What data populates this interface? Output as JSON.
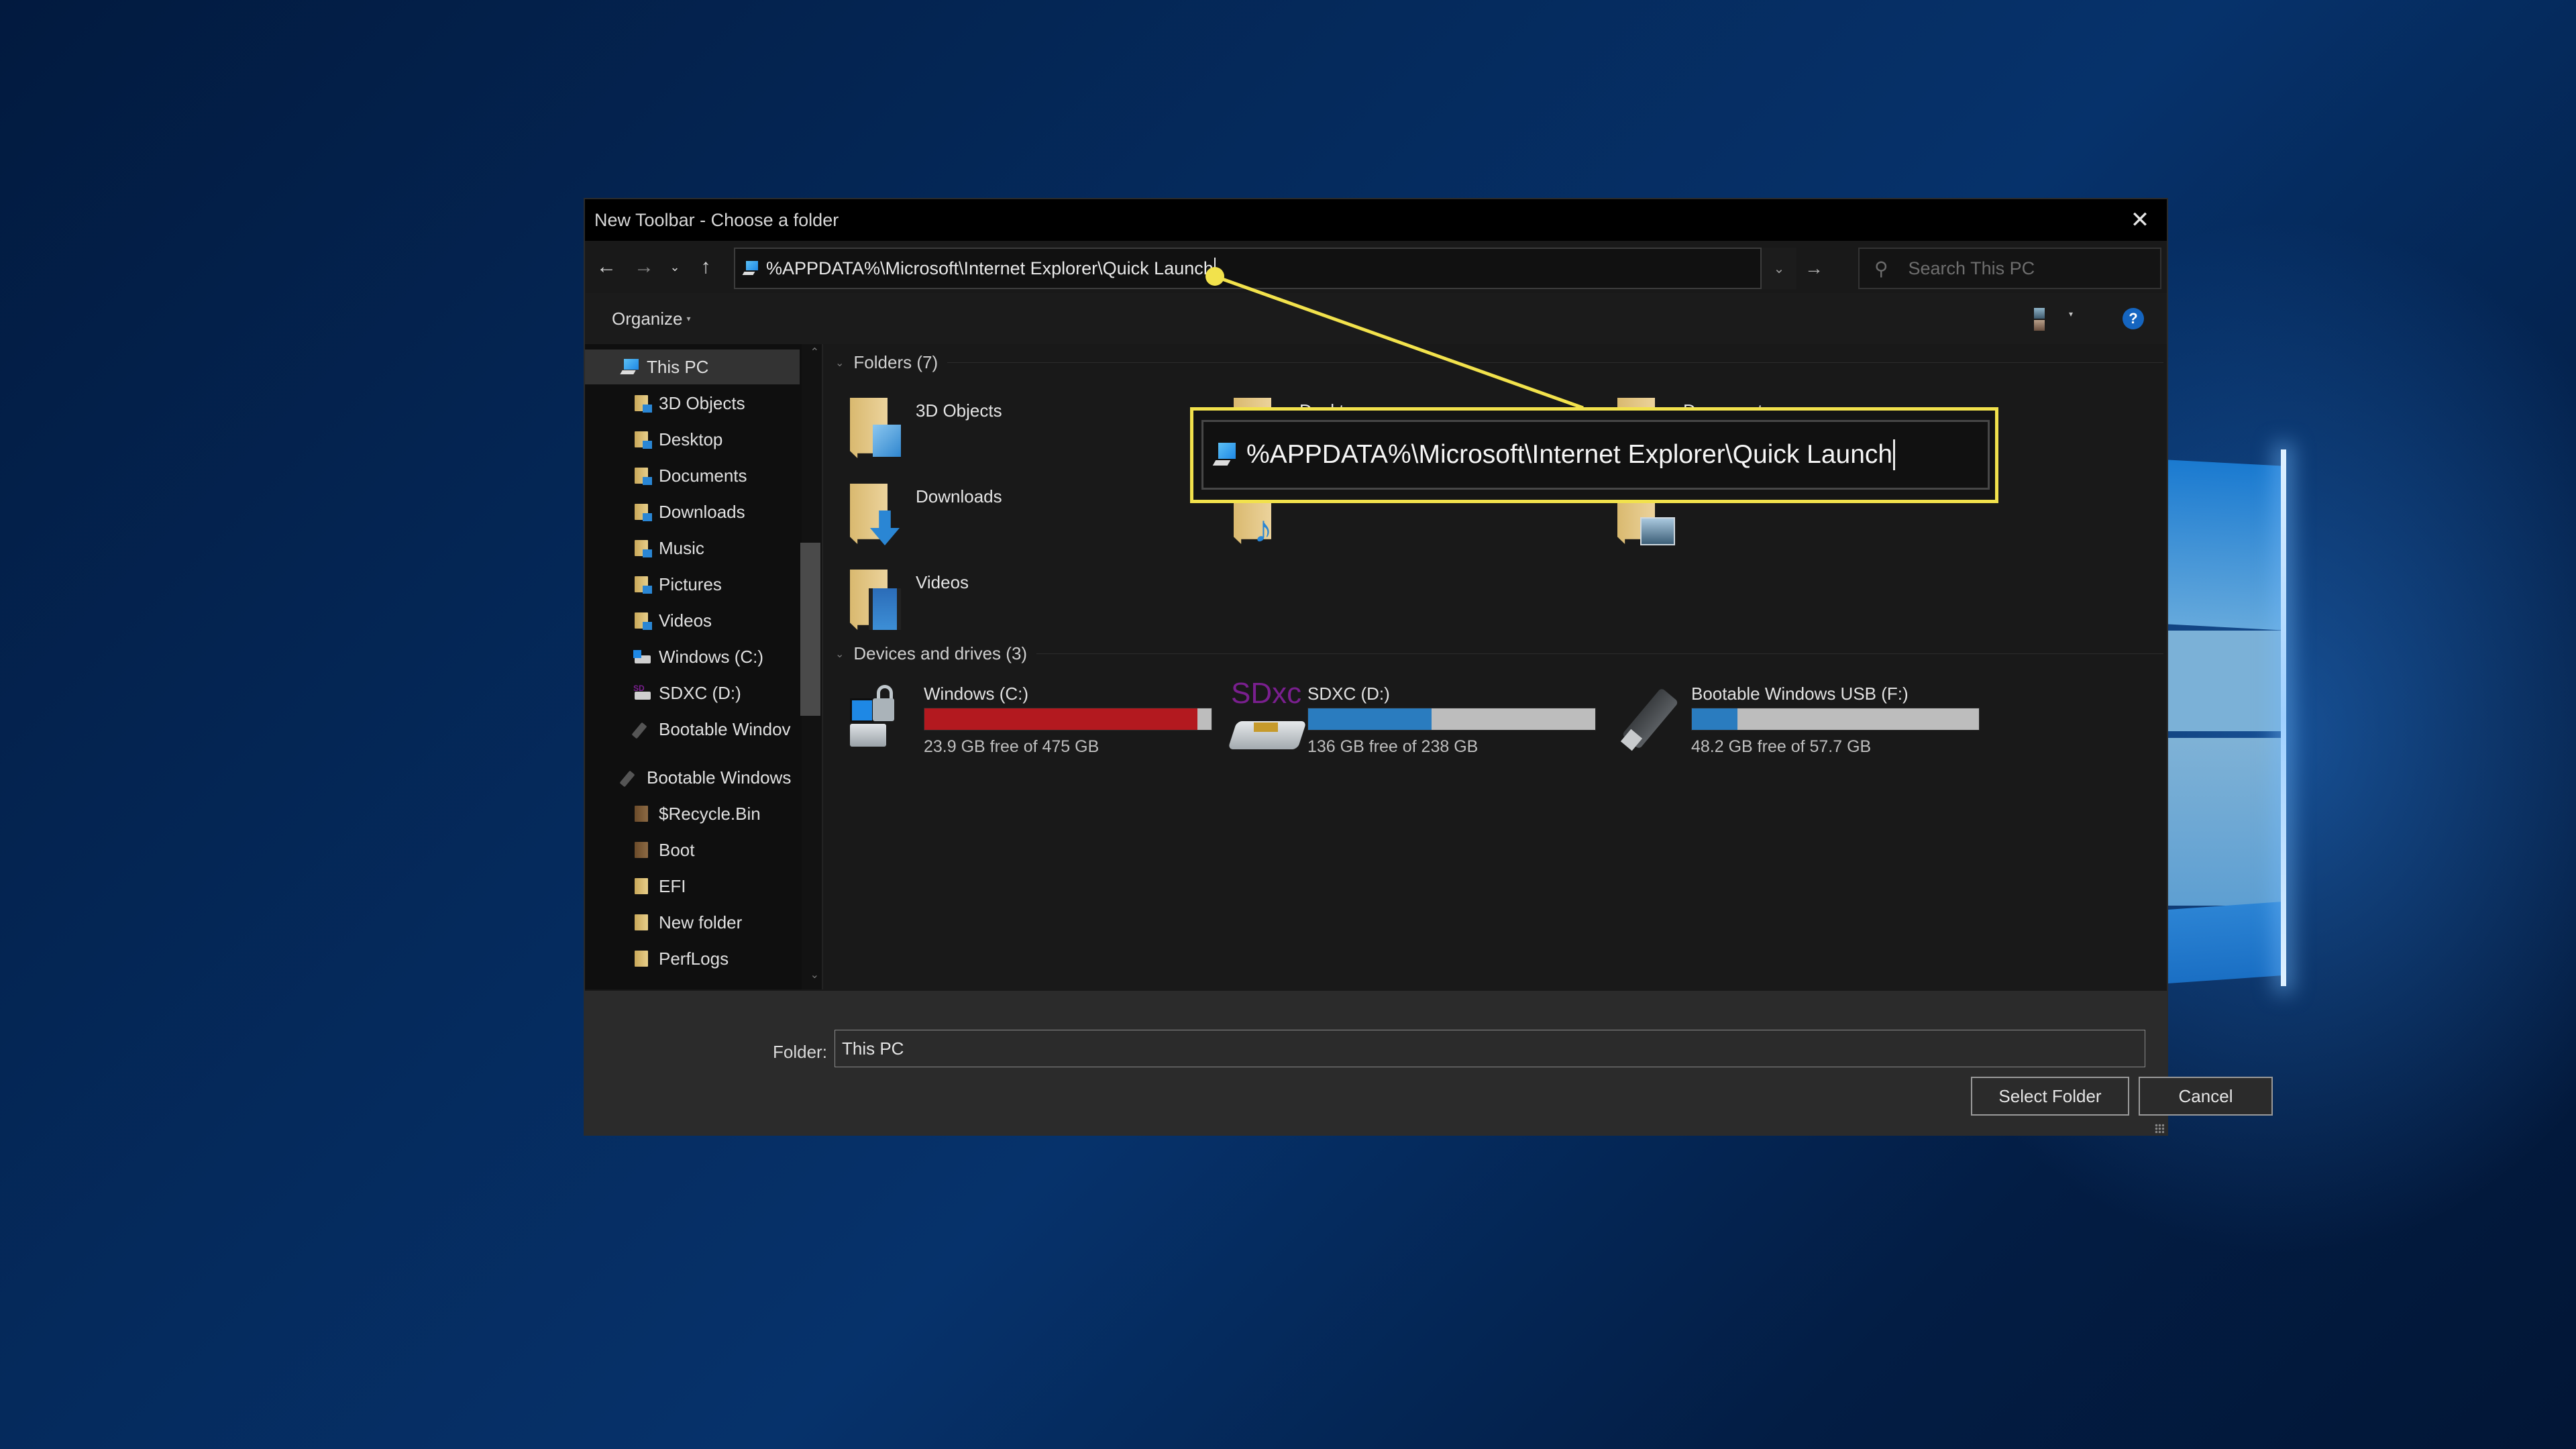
{
  "dialog": {
    "title": "New Toolbar - Choose a folder",
    "close_label": "✕"
  },
  "navigation": {
    "back_icon": "←",
    "forward_icon": "→",
    "recent_icon": "⌄",
    "up_icon": "↑",
    "address_value": "%APPDATA%\\Microsoft\\Internet Explorer\\Quick Launch",
    "dropdown_icon": "⌄",
    "go_icon": "→",
    "search_placeholder": "Search This PC",
    "search_icon": "⚲"
  },
  "toolbar": {
    "organize_label": "Organize",
    "organize_caret": "▾",
    "view_caret": "▾",
    "help_label": "?"
  },
  "sidebar": {
    "items": [
      {
        "label": "This PC",
        "icon": "pc-icon",
        "level": 0,
        "selected": true
      },
      {
        "label": "3D Objects",
        "icon": "folder-3d-objects-icon",
        "level": 1
      },
      {
        "label": "Desktop",
        "icon": "folder-desktop-icon",
        "level": 1
      },
      {
        "label": "Documents",
        "icon": "folder-documents-icon",
        "level": 1
      },
      {
        "label": "Downloads",
        "icon": "folder-downloads-icon",
        "level": 1
      },
      {
        "label": "Music",
        "icon": "folder-music-icon",
        "level": 1
      },
      {
        "label": "Pictures",
        "icon": "folder-pictures-icon",
        "level": 1
      },
      {
        "label": "Videos",
        "icon": "folder-videos-icon",
        "level": 1
      },
      {
        "label": "Windows (C:)",
        "icon": "windows-drive-icon",
        "level": 1
      },
      {
        "label": "SDXC (D:)",
        "icon": "sdxc-drive-icon",
        "level": 1
      },
      {
        "label": "Bootable Windov",
        "icon": "usb-drive-icon",
        "level": 1
      },
      {
        "label": "Bootable Windows",
        "icon": "usb-drive-icon",
        "level": 0
      },
      {
        "label": "$Recycle.Bin",
        "icon": "folder-icon",
        "level": 1
      },
      {
        "label": "Boot",
        "icon": "folder-icon",
        "level": 1
      },
      {
        "label": "EFI",
        "icon": "folder-icon",
        "level": 1
      },
      {
        "label": "New folder",
        "icon": "folder-icon",
        "level": 1
      },
      {
        "label": "PerfLogs",
        "icon": "folder-icon",
        "level": 1
      }
    ],
    "scroll_up": "⌃",
    "scroll_down": "⌄"
  },
  "content": {
    "folders_header": "Folders (7)",
    "folders": [
      {
        "label": "3D Objects"
      },
      {
        "label": "Desktop"
      },
      {
        "label": "Documents"
      },
      {
        "label": "Downloads"
      },
      {
        "label": "Music"
      },
      {
        "label": "Pictures"
      },
      {
        "label": "Videos"
      }
    ],
    "drives_header": "Devices and drives (3)",
    "drives": [
      {
        "name": "Windows (C:)",
        "free_text": "23.9 GB free of 475 GB",
        "used_fraction": 0.95,
        "bar_color": "#b3191f"
      },
      {
        "name": "SDXC (D:)",
        "free_text": "136 GB free of 238 GB",
        "used_fraction": 0.43,
        "bar_color": "#2a7cbf"
      },
      {
        "name": "Bootable Windows USB (F:)",
        "free_text": "48.2 GB free of 57.7 GB",
        "used_fraction": 0.16,
        "bar_color": "#2a7cbf"
      }
    ],
    "chevron": "⌄",
    "sdxc_logo": "SDxc"
  },
  "footer": {
    "folder_label": "Folder:",
    "folder_value": "This PC",
    "select_label": "Select Folder",
    "cancel_label": "Cancel"
  },
  "callout": {
    "text": "%APPDATA%\\Microsoft\\Internet Explorer\\Quick Launch",
    "color": "#f2e24c"
  }
}
